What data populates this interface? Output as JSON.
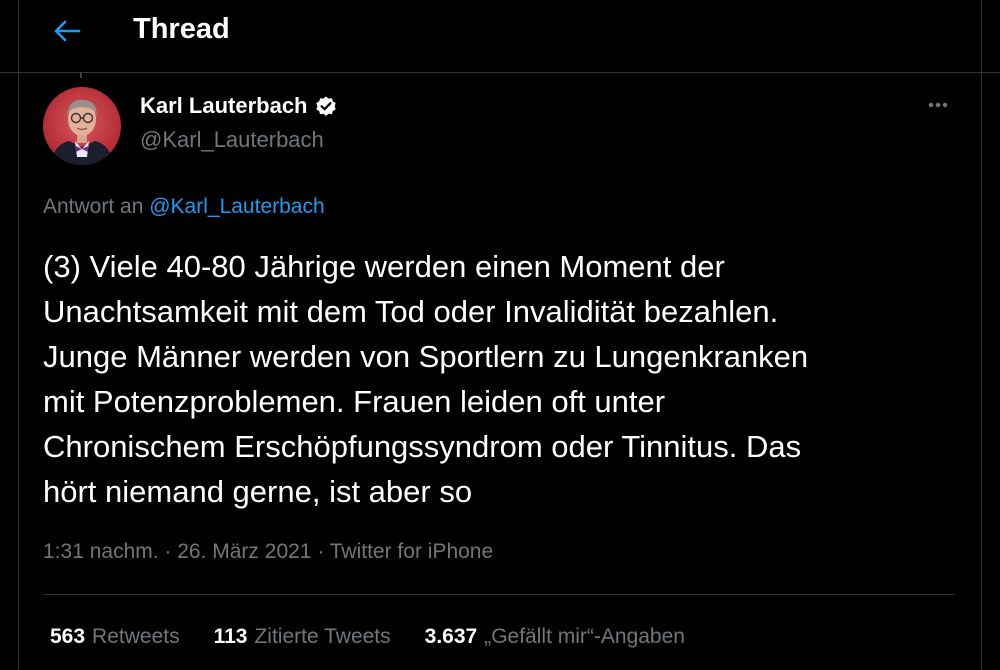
{
  "header": {
    "title": "Thread",
    "back_icon": "arrow-left-icon",
    "accent": "#1d9bf0"
  },
  "tweet": {
    "author_name": "Karl Lauterbach",
    "handle": "@Karl_Lauterbach",
    "verified_icon": "verified-badge-icon",
    "more_icon": "more-horizontal-icon",
    "reply_prefix": "Antwort an",
    "reply_handle": "@Karl_Lauterbach",
    "text": "(3) Viele 40-80 Jährige werden einen Moment der\nUnachtsamkeit mit dem Tod oder Invalidität bezahlen.\nJunge Männer werden von Sportlern zu Lungenkranken\nmit Potenzproblemen. Frauen leiden oft unter\nChronischem Erschöpfungssyndrom oder Tinnitus. Das\nhört niemand gerne, ist aber so",
    "meta": "1:31 nachm. · 26. März 2021 · Twitter for iPhone"
  },
  "stats": [
    {
      "count": "563",
      "label": "Retweets"
    },
    {
      "count": "113",
      "label": "Zitierte Tweets"
    },
    {
      "count": "3.637",
      "label": "„Gefällt mir“-Angaben"
    }
  ]
}
